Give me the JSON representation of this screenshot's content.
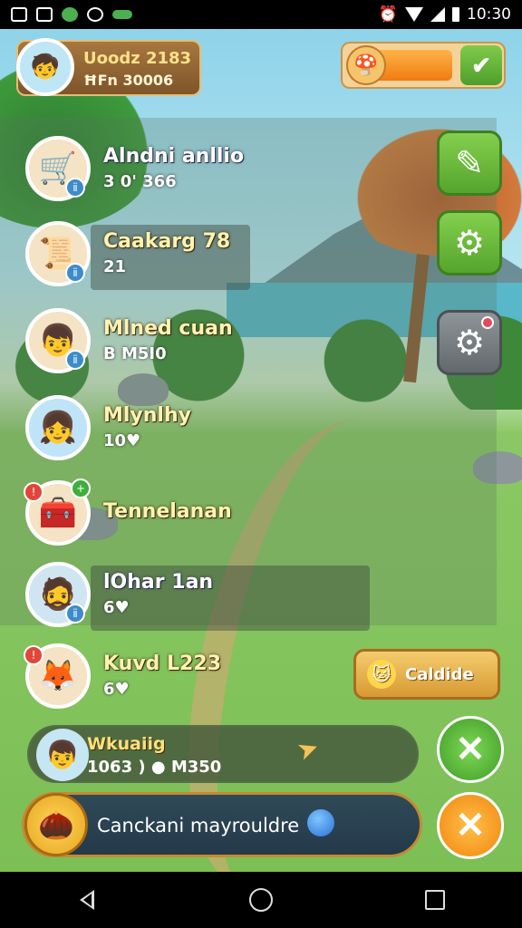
{
  "status_bar": {
    "time": "10:30",
    "icons": [
      "gallery-icon",
      "notification-icon",
      "game-icon",
      "chat-icon",
      "alarm-icon",
      "wifi-icon",
      "signal-icon",
      "battery-icon"
    ]
  },
  "profile": {
    "name": "Uoodz 2183",
    "sub": "ĦFn 30006",
    "avatar_icon": "player-avatar-icon"
  },
  "energy": {
    "level_percent": 72,
    "icon": "mushroom-face-icon",
    "confirm_icon": "checkmark-icon"
  },
  "friends": [
    {
      "name": "Alndni anllio",
      "sub": "3 0' 366",
      "icon": "wagon-icon",
      "badge": "blue",
      "name_style": "white"
    },
    {
      "name": "Caakarg 78",
      "sub": "21",
      "icon": "scroll-icon",
      "badge": "blue",
      "name_style": "yellow"
    },
    {
      "name": "Mlned cuan",
      "sub": "B M5I0",
      "icon": "boy-avatar-icon",
      "badge": "blue",
      "name_style": "yellow"
    },
    {
      "name": "Mlynlhy",
      "sub": "10♥",
      "icon": "girl-avatar-icon",
      "badge": "none",
      "name_style": "yellow"
    },
    {
      "name": "Tennelanan",
      "sub": "",
      "icon": "treasure-chest-icon",
      "badge": "red-green",
      "name_style": "yellow"
    },
    {
      "name": "lOhar 1an",
      "sub": "6♥",
      "icon": "viking-avatar-icon",
      "badge": "blue",
      "name_style": "white"
    },
    {
      "name": "Kuvd L223",
      "sub": "6♥",
      "icon": "pets-icon",
      "badge": "red",
      "name_style": "yellow"
    }
  ],
  "side_buttons": [
    {
      "name": "edit-button",
      "icon": "pencil-icon",
      "color": "#6bbf3e"
    },
    {
      "name": "settings-button",
      "icon": "gear-icon",
      "color": "#6bbf3e"
    },
    {
      "name": "options-button",
      "icon": "gear-icon",
      "color": "#777f83"
    }
  ],
  "guide_button": {
    "label": "Caldide",
    "icon": "cat-face-icon"
  },
  "current_player": {
    "name": "Wkuaiig",
    "sub": "1063 ) ● M350",
    "icon": "player-avatar-icon",
    "pointer_icon": "pointer-icon"
  },
  "action_bar": {
    "text": "Canckani mayrouldre",
    "icon": "acorn-icon",
    "dot_icon": "blue-orb-icon"
  },
  "colors": {
    "accent_green": "#5fb132",
    "accent_orange": "#f39a1b",
    "bar_bg": "#2f4a58",
    "gold": "#e8b14a"
  },
  "nav": {
    "back": "back-icon",
    "home": "home-icon",
    "recent": "recent-apps-icon"
  }
}
